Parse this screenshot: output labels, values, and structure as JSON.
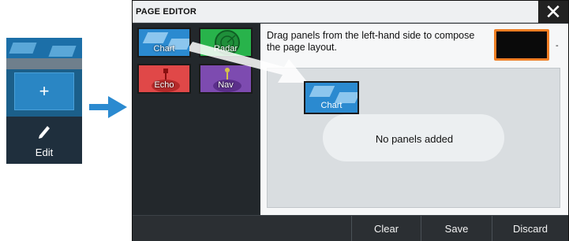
{
  "device": {
    "add_label": "+",
    "edit_label": "Edit"
  },
  "dialog": {
    "title": "PAGE EDITOR",
    "close_label": "✕",
    "instructions": "Drag panels from the left-hand side to compose the page layout.",
    "color_swatch": "#000000",
    "color_accent": "#f07e24",
    "empty_message": "No panels added",
    "dragged_panel": "Chart"
  },
  "panels": [
    {
      "label": "Chart",
      "icon": "chart-icon",
      "color": "#2b8ad0"
    },
    {
      "label": "Radar",
      "icon": "radar-icon",
      "color": "#28b34b"
    },
    {
      "label": "Echo",
      "icon": "echo-icon",
      "color": "#e04848"
    },
    {
      "label": "Nav",
      "icon": "nav-icon",
      "color": "#7d4bb0"
    }
  ],
  "footer": {
    "clear_label": "Clear",
    "save_label": "Save",
    "discard_label": "Discard"
  }
}
